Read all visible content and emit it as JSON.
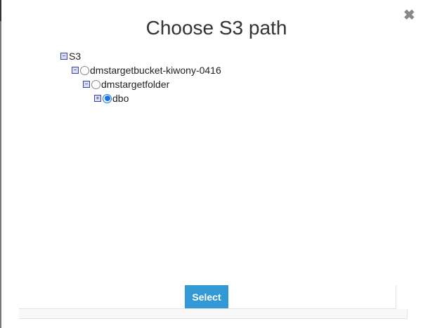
{
  "dialog": {
    "title": "Choose S3 path",
    "close_icon": "close-icon",
    "select_label": "Select",
    "accent_color": "#3399d6"
  },
  "tree": {
    "root": {
      "label": "S3",
      "expanded": true
    },
    "bucket": {
      "label": "dmstargetbucket-kiwony-0416",
      "expanded": true,
      "selected": false
    },
    "folder": {
      "label": "dmstargetfolder",
      "expanded": true,
      "selected": false
    },
    "dbo": {
      "label": "dbo",
      "expanded": false,
      "selected": true
    }
  }
}
